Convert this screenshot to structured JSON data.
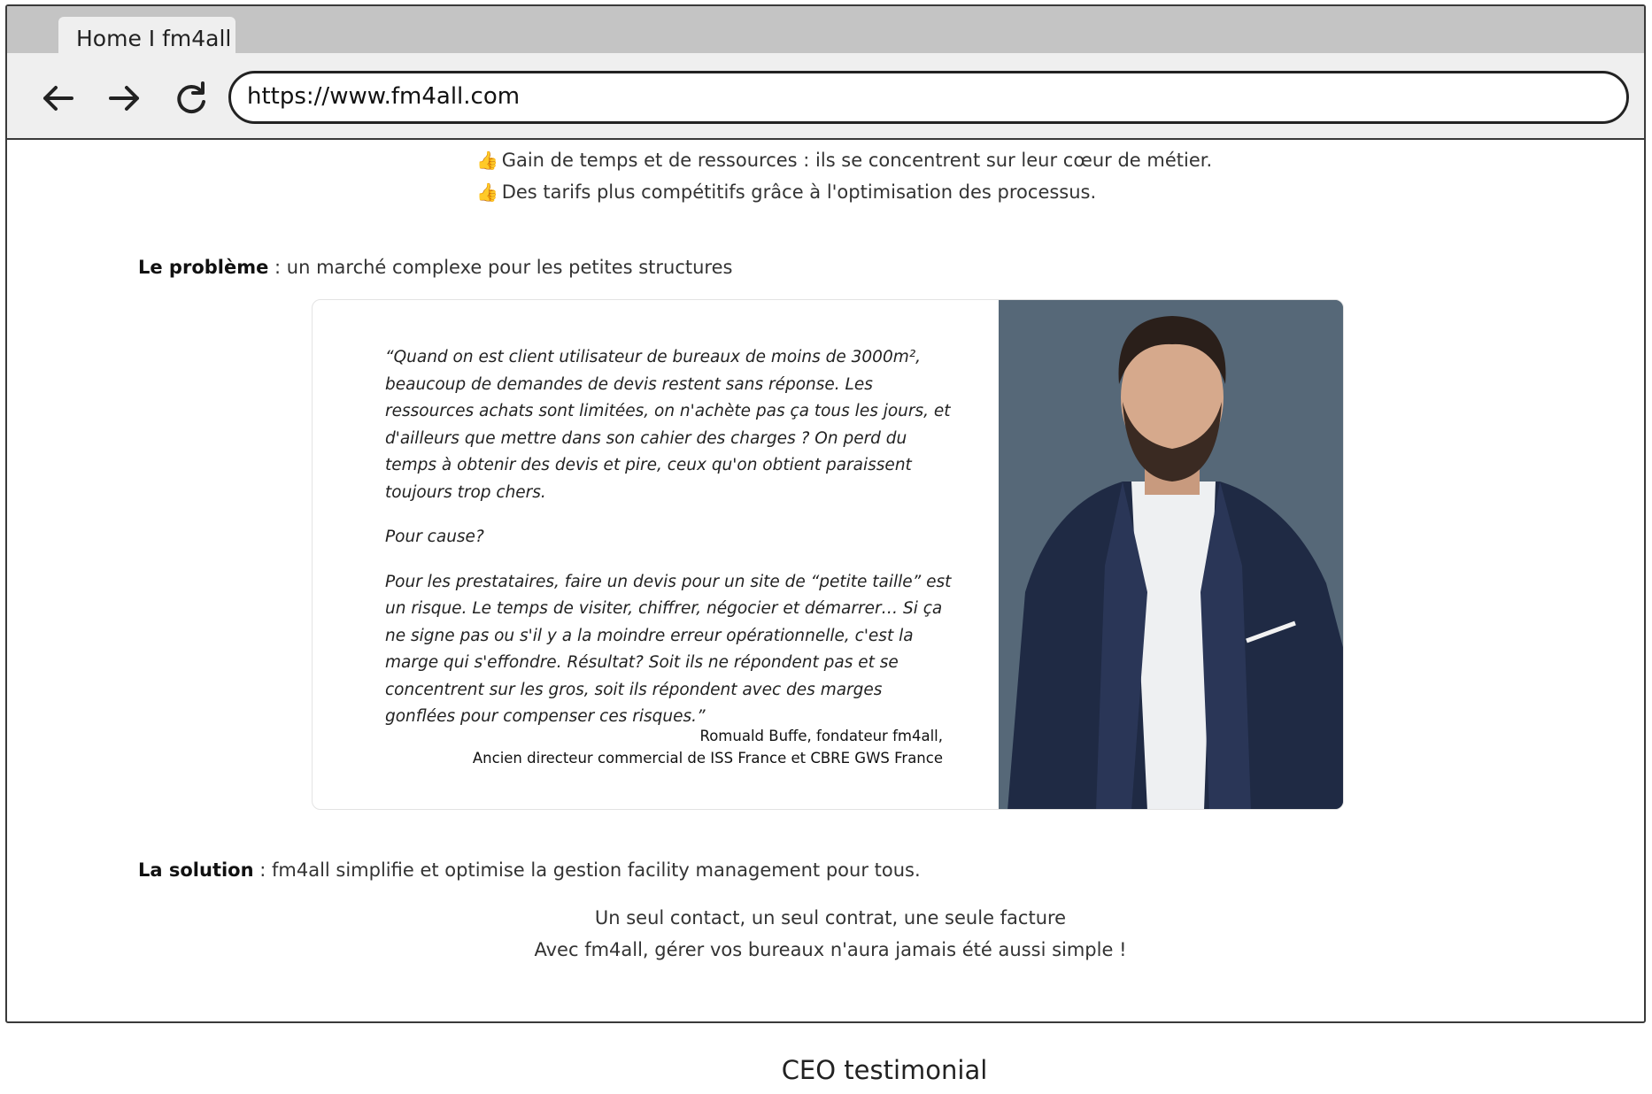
{
  "browser": {
    "tab_title": "Home I fm4all",
    "url": "https://www.fm4all.com",
    "icons": {
      "back": "arrow-left-icon",
      "forward": "arrow-right-icon",
      "reload": "reload-icon"
    }
  },
  "benefits": [
    "Gain de temps et de ressources : ils se concentrent sur leur cœur de métier.",
    "Des tarifs plus compétitifs grâce à l'optimisation des processus."
  ],
  "problem": {
    "label": "Le problème",
    "text": " : un marché complexe pour les petites structures"
  },
  "testimonial": {
    "quote_p1": "“Quand on est client utilisateur de bureaux de moins de 3000m², beaucoup de demandes de devis restent sans réponse.  Les ressources achats sont limitées, on n'achète pas ça tous les jours, et d'ailleurs que mettre dans son cahier des charges ? On perd du temps à obtenir des devis et pire, ceux qu'on obtient paraissent toujours trop chers.",
    "quote_p2": "Pour cause?",
    "quote_p3": "Pour les prestataires, faire un devis pour un site de “petite taille” est un risque.  Le temps de visiter, chiffrer, négocier et démarrer… Si ça ne signe pas ou s'il y a la moindre erreur opérationnelle, c'est la marge qui s'effondre.  Résultat? Soit ils ne répondent pas et se concentrent sur les gros, soit ils répondent avec des marges gonflées pour compenser ces risques.”",
    "author": "Romuald  Buffe, fondateur fm4all,",
    "author_title": "Ancien directeur commercial de  ISS  France et CBRE GWS  France"
  },
  "solution": {
    "label": "La solution",
    "text": " : fm4all simplifie et optimise la gestion facility management pour tous."
  },
  "tagline_1": "Un seul contact, un seul contrat, une seule facture",
  "tagline_2": "Avec fm4all, gérer vos bureaux n'aura jamais été aussi simple !",
  "caption": "CEO testimonial",
  "colors": {
    "photo_background": "#566878",
    "suit": "#1f2a44",
    "chrome": "#c4c4c4",
    "thumb": "#e8a317"
  }
}
